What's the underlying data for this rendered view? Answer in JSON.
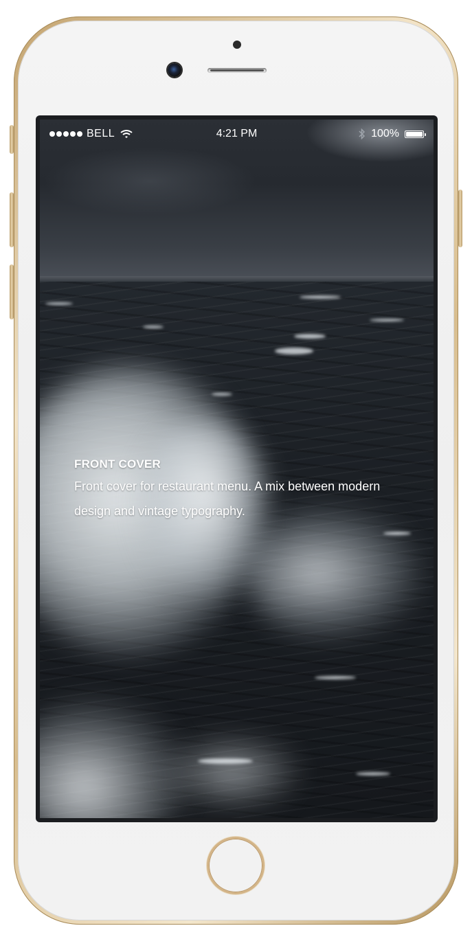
{
  "status_bar": {
    "signal_bars": 5,
    "carrier": "BELL",
    "wifi_icon": "wifi-icon",
    "time": "4:21 PM",
    "bluetooth_icon": "bluetooth-icon",
    "battery_percent": "100%",
    "battery_level": 1.0
  },
  "cover": {
    "title": "FRONT COVER",
    "description": "Front cover for restaurant menu. A mix between modern design and vintage typography."
  },
  "device": {
    "frame_color": "#d8bd8e",
    "face_color": "#f1f1f1"
  },
  "icons": [
    "wifi-icon",
    "bluetooth-icon",
    "battery-icon",
    "home-button"
  ]
}
